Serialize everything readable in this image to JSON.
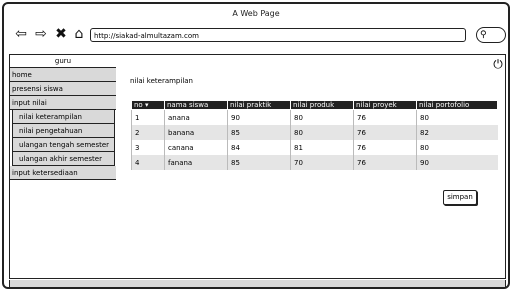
{
  "window": {
    "title": "A Web Page"
  },
  "browser": {
    "url": "http://siakad-almultazam.com"
  },
  "sidebar": {
    "header": "guru",
    "items": [
      {
        "label": "home"
      },
      {
        "label": "presensi siswa"
      },
      {
        "label": "input nilai"
      },
      {
        "label": "nilai keterampilan"
      },
      {
        "label": "nilai pengetahuan"
      },
      {
        "label": "ulangan tengah semester"
      },
      {
        "label": "ulangan akhir semester"
      },
      {
        "label": "input ketersediaan"
      }
    ]
  },
  "main": {
    "title": "nilai keterampilan",
    "save_label": "simpan",
    "table": {
      "headers": [
        "no",
        "nama siswa",
        "nilai praktik",
        "nilai produk",
        "nilai proyek",
        "nilai portofolio"
      ],
      "rows": [
        [
          "1",
          "anana",
          "90",
          "80",
          "76",
          "80"
        ],
        [
          "2",
          "banana",
          "85",
          "80",
          "76",
          "82"
        ],
        [
          "3",
          "canana",
          "84",
          "81",
          "76",
          "80"
        ],
        [
          "4",
          "fanana",
          "85",
          "70",
          "76",
          "90"
        ]
      ]
    }
  },
  "icons": [
    "back-icon",
    "forward-icon",
    "close-icon",
    "home-icon",
    "search-icon",
    "power-icon"
  ]
}
